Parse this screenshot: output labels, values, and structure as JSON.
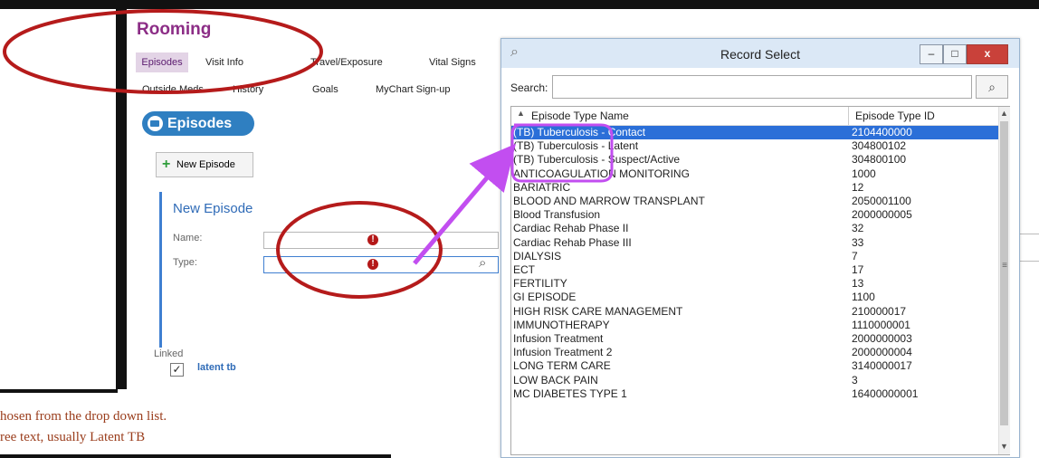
{
  "app": {
    "title": "Rooming",
    "tabs_row1": [
      "Episodes",
      "Visit Info",
      "Travel/Exposure",
      "Vital Signs"
    ],
    "tabs_row2": [
      "Outside Meds",
      "History",
      "Goals",
      "MyChart Sign-up"
    ],
    "active_tab": "Episodes"
  },
  "episodes_panel": {
    "header": "Episodes",
    "new_episode_button": "New Episode",
    "new_episode": {
      "title": "New Episode",
      "name_label": "Name:",
      "type_label": "Type:",
      "name_value": "",
      "type_value": ""
    },
    "linked_label": "Linked",
    "linked_items": [
      {
        "label": "latent tb",
        "checked": true
      }
    ]
  },
  "caption": {
    "line1": "hosen from the drop down list.",
    "line2": "ree text, usually Latent TB"
  },
  "dialog": {
    "title": "Record Select",
    "search_label": "Search:",
    "search_value": "",
    "columns": [
      "Episode Type Name",
      "Episode Type ID"
    ],
    "rows": [
      {
        "name": "(TB) Tuberculosis - Contact",
        "id": "2104400000",
        "selected": true
      },
      {
        "name": "(TB) Tuberculosis - Latent",
        "id": "304800102",
        "selected": false
      },
      {
        "name": "(TB) Tuberculosis - Suspect/Active",
        "id": "304800100",
        "selected": false
      },
      {
        "name": "ANTICOAGULATION MONITORING",
        "id": "1000",
        "selected": false
      },
      {
        "name": "BARIATRIC",
        "id": "12",
        "selected": false
      },
      {
        "name": "BLOOD AND MARROW TRANSPLANT",
        "id": "2050001100",
        "selected": false
      },
      {
        "name": "Blood Transfusion",
        "id": "2000000005",
        "selected": false
      },
      {
        "name": "Cardiac Rehab Phase II",
        "id": "32",
        "selected": false
      },
      {
        "name": "Cardiac Rehab Phase III",
        "id": "33",
        "selected": false
      },
      {
        "name": "DIALYSIS",
        "id": "7",
        "selected": false
      },
      {
        "name": "ECT",
        "id": "17",
        "selected": false
      },
      {
        "name": "FERTILITY",
        "id": "13",
        "selected": false
      },
      {
        "name": "GI EPISODE",
        "id": "1100",
        "selected": false
      },
      {
        "name": "HIGH RISK CARE MANAGEMENT",
        "id": "210000017",
        "selected": false
      },
      {
        "name": "IMMUNOTHERAPY",
        "id": "1110000001",
        "selected": false
      },
      {
        "name": "Infusion Treatment",
        "id": "2000000003",
        "selected": false
      },
      {
        "name": "Infusion Treatment 2",
        "id": "2000000004",
        "selected": false
      },
      {
        "name": "LONG TERM CARE",
        "id": "3140000017",
        "selected": false
      },
      {
        "name": "LOW BACK PAIN",
        "id": "3",
        "selected": false
      },
      {
        "name": "MC DIABETES TYPE 1",
        "id": "16400000001",
        "selected": false
      }
    ],
    "window_buttons": [
      "minimize",
      "maximize",
      "close"
    ]
  },
  "icons": {
    "search": "search-icon",
    "error": "error-icon",
    "folder": "folder-icon",
    "plus": "plus-icon"
  },
  "colors": {
    "annotation_red": "#b51b1b",
    "arrow_purple": "#c24ef0",
    "brand_purple": "#8c2d86",
    "selection_blue": "#2b6fd8"
  }
}
